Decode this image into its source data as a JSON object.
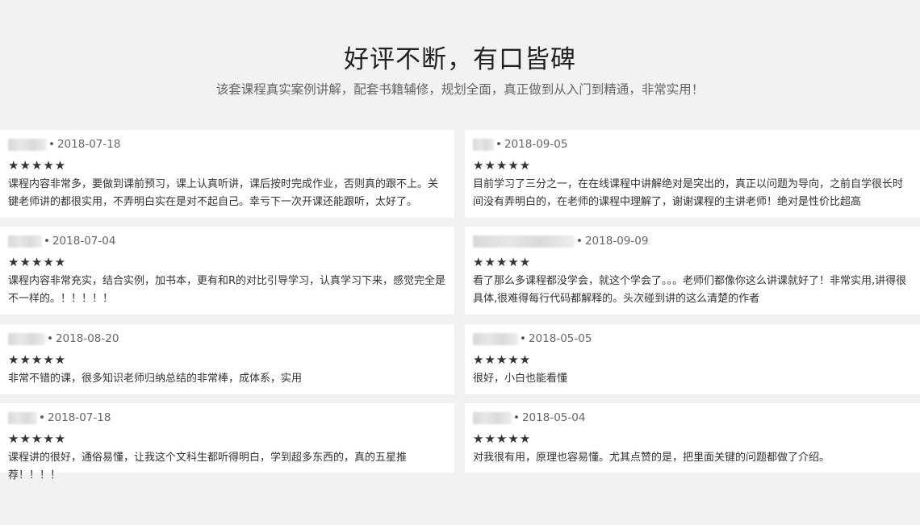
{
  "header": {
    "title": "好评不断，有口皆碑",
    "subtitle": "该套课程真实案例讲解，配套书籍辅修，规划全面，真正做到从入门到精通，非常实用！"
  },
  "reviews": [
    {
      "date": "2018-07-18",
      "stars": "★★★★★",
      "text": "课程内容非常多，要做到课前预习，课上认真听讲，课后按时完成作业，否则真的跟不上。关键老师讲的都很实用，不弄明白实在是对不起自己。幸亏下一次开课还能跟听，太好了。"
    },
    {
      "date": "2018-09-05",
      "stars": "★★★★★",
      "text": "目前学习了三分之一，在在线课程中讲解绝对是突出的，真正以问题为导向，之前自学很长时间没有弄明白的，在老师的课程中理解了，谢谢课程的主讲老师！绝对是性价比超高"
    },
    {
      "date": "2018-07-04",
      "stars": "★★★★★",
      "text": "课程内容非常充实，结合实例，加书本，更有和R的对比引导学习，认真学习下来，感觉完全是不一样的。！！！！！"
    },
    {
      "date": "2018-09-09",
      "stars": "★★★★★",
      "text": "看了那么多课程都没学会，就这个学会了。。。老师们都像你这么讲课就好了！非常实用,讲得很具体,很难得每行代码都解释的。头次碰到讲的这么清楚的作者"
    },
    {
      "date": "2018-08-20",
      "stars": "★★★★★",
      "text": "非常不错的课，很多知识老师归纳总结的非常棒，成体系，实用"
    },
    {
      "date": "2018-05-05",
      "stars": "★★★★★",
      "text": "很好，小白也能看懂"
    },
    {
      "date": "2018-07-18",
      "stars": "★★★★★",
      "text": "课程讲的很好，通俗易懂，让我这个文科生都听得明白，学到超多东西的，真的五星推荐！！！！"
    },
    {
      "date": "2018-05-04",
      "stars": "★★★★★",
      "text": "对我很有用，原理也容易懂。尤其点赞的是，把里面关键的问题都做了介绍。"
    }
  ]
}
